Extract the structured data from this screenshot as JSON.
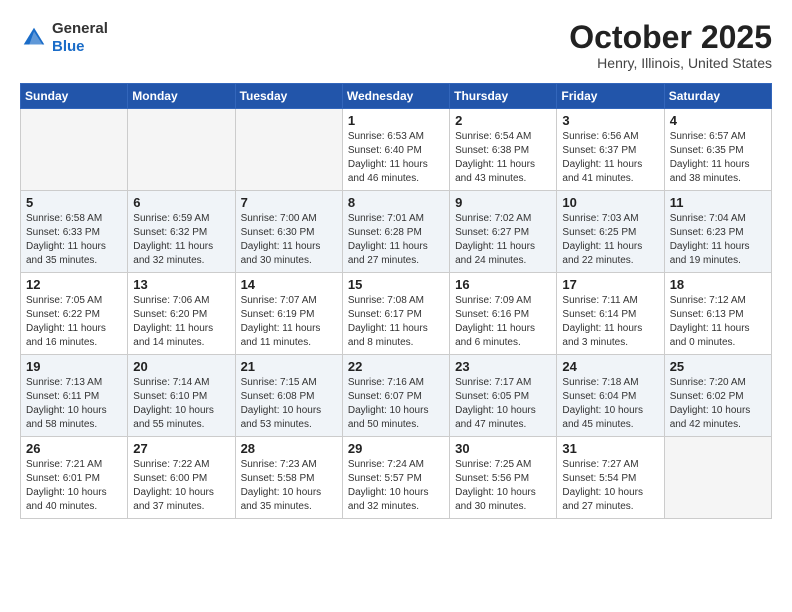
{
  "header": {
    "logo_general": "General",
    "logo_blue": "Blue",
    "month": "October 2025",
    "location": "Henry, Illinois, United States"
  },
  "days_of_week": [
    "Sunday",
    "Monday",
    "Tuesday",
    "Wednesday",
    "Thursday",
    "Friday",
    "Saturday"
  ],
  "weeks": [
    [
      {
        "day": "",
        "info": ""
      },
      {
        "day": "",
        "info": ""
      },
      {
        "day": "",
        "info": ""
      },
      {
        "day": "1",
        "info": "Sunrise: 6:53 AM\nSunset: 6:40 PM\nDaylight: 11 hours\nand 46 minutes."
      },
      {
        "day": "2",
        "info": "Sunrise: 6:54 AM\nSunset: 6:38 PM\nDaylight: 11 hours\nand 43 minutes."
      },
      {
        "day": "3",
        "info": "Sunrise: 6:56 AM\nSunset: 6:37 PM\nDaylight: 11 hours\nand 41 minutes."
      },
      {
        "day": "4",
        "info": "Sunrise: 6:57 AM\nSunset: 6:35 PM\nDaylight: 11 hours\nand 38 minutes."
      }
    ],
    [
      {
        "day": "5",
        "info": "Sunrise: 6:58 AM\nSunset: 6:33 PM\nDaylight: 11 hours\nand 35 minutes."
      },
      {
        "day": "6",
        "info": "Sunrise: 6:59 AM\nSunset: 6:32 PM\nDaylight: 11 hours\nand 32 minutes."
      },
      {
        "day": "7",
        "info": "Sunrise: 7:00 AM\nSunset: 6:30 PM\nDaylight: 11 hours\nand 30 minutes."
      },
      {
        "day": "8",
        "info": "Sunrise: 7:01 AM\nSunset: 6:28 PM\nDaylight: 11 hours\nand 27 minutes."
      },
      {
        "day": "9",
        "info": "Sunrise: 7:02 AM\nSunset: 6:27 PM\nDaylight: 11 hours\nand 24 minutes."
      },
      {
        "day": "10",
        "info": "Sunrise: 7:03 AM\nSunset: 6:25 PM\nDaylight: 11 hours\nand 22 minutes."
      },
      {
        "day": "11",
        "info": "Sunrise: 7:04 AM\nSunset: 6:23 PM\nDaylight: 11 hours\nand 19 minutes."
      }
    ],
    [
      {
        "day": "12",
        "info": "Sunrise: 7:05 AM\nSunset: 6:22 PM\nDaylight: 11 hours\nand 16 minutes."
      },
      {
        "day": "13",
        "info": "Sunrise: 7:06 AM\nSunset: 6:20 PM\nDaylight: 11 hours\nand 14 minutes."
      },
      {
        "day": "14",
        "info": "Sunrise: 7:07 AM\nSunset: 6:19 PM\nDaylight: 11 hours\nand 11 minutes."
      },
      {
        "day": "15",
        "info": "Sunrise: 7:08 AM\nSunset: 6:17 PM\nDaylight: 11 hours\nand 8 minutes."
      },
      {
        "day": "16",
        "info": "Sunrise: 7:09 AM\nSunset: 6:16 PM\nDaylight: 11 hours\nand 6 minutes."
      },
      {
        "day": "17",
        "info": "Sunrise: 7:11 AM\nSunset: 6:14 PM\nDaylight: 11 hours\nand 3 minutes."
      },
      {
        "day": "18",
        "info": "Sunrise: 7:12 AM\nSunset: 6:13 PM\nDaylight: 11 hours\nand 0 minutes."
      }
    ],
    [
      {
        "day": "19",
        "info": "Sunrise: 7:13 AM\nSunset: 6:11 PM\nDaylight: 10 hours\nand 58 minutes."
      },
      {
        "day": "20",
        "info": "Sunrise: 7:14 AM\nSunset: 6:10 PM\nDaylight: 10 hours\nand 55 minutes."
      },
      {
        "day": "21",
        "info": "Sunrise: 7:15 AM\nSunset: 6:08 PM\nDaylight: 10 hours\nand 53 minutes."
      },
      {
        "day": "22",
        "info": "Sunrise: 7:16 AM\nSunset: 6:07 PM\nDaylight: 10 hours\nand 50 minutes."
      },
      {
        "day": "23",
        "info": "Sunrise: 7:17 AM\nSunset: 6:05 PM\nDaylight: 10 hours\nand 47 minutes."
      },
      {
        "day": "24",
        "info": "Sunrise: 7:18 AM\nSunset: 6:04 PM\nDaylight: 10 hours\nand 45 minutes."
      },
      {
        "day": "25",
        "info": "Sunrise: 7:20 AM\nSunset: 6:02 PM\nDaylight: 10 hours\nand 42 minutes."
      }
    ],
    [
      {
        "day": "26",
        "info": "Sunrise: 7:21 AM\nSunset: 6:01 PM\nDaylight: 10 hours\nand 40 minutes."
      },
      {
        "day": "27",
        "info": "Sunrise: 7:22 AM\nSunset: 6:00 PM\nDaylight: 10 hours\nand 37 minutes."
      },
      {
        "day": "28",
        "info": "Sunrise: 7:23 AM\nSunset: 5:58 PM\nDaylight: 10 hours\nand 35 minutes."
      },
      {
        "day": "29",
        "info": "Sunrise: 7:24 AM\nSunset: 5:57 PM\nDaylight: 10 hours\nand 32 minutes."
      },
      {
        "day": "30",
        "info": "Sunrise: 7:25 AM\nSunset: 5:56 PM\nDaylight: 10 hours\nand 30 minutes."
      },
      {
        "day": "31",
        "info": "Sunrise: 7:27 AM\nSunset: 5:54 PM\nDaylight: 10 hours\nand 27 minutes."
      },
      {
        "day": "",
        "info": ""
      }
    ]
  ]
}
